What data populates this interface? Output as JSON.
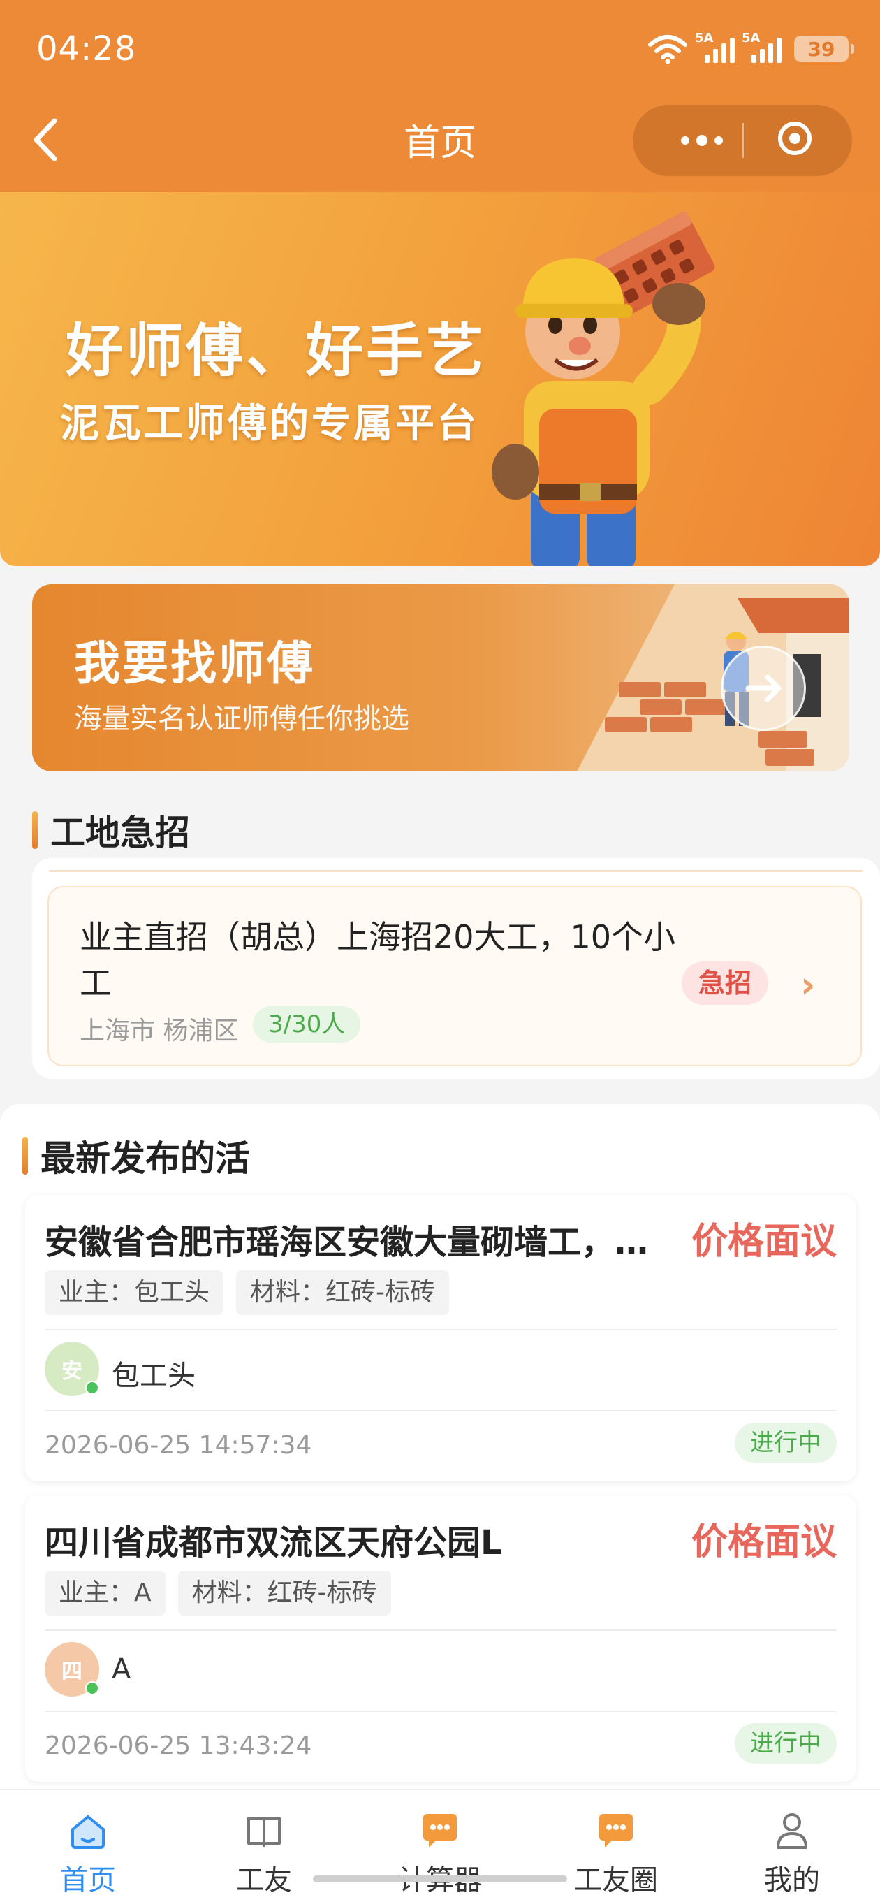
{
  "status_bar": {
    "time": "04:28",
    "net1": "5A",
    "net2": "5A",
    "battery": "39"
  },
  "nav": {
    "title": "首页"
  },
  "hero": {
    "title": "好师傅、好手艺",
    "subtitle": "泥瓦工师傅的专属平台"
  },
  "find_master": {
    "title": "我要找师傅",
    "subtitle": "海量实名认证师傅任你挑选"
  },
  "urgent": {
    "heading": "工地急招",
    "item": {
      "title": "业主直招（胡总）上海招20大工，10个小工",
      "location": "上海市 杨浦区",
      "count": "3/30人",
      "badge": "急招"
    }
  },
  "latest": {
    "heading": "最新发布的活",
    "jobs": [
      {
        "title": "安徽省合肥市瑶海区安徽大量砌墙工，…",
        "price": "价格面议",
        "owner_tag": "业主：包工头",
        "material_tag": "材料：红砖-标砖",
        "avatar_char": "安",
        "poster": "包工头",
        "time": "2026-06-25 14:57:34",
        "status": "进行中"
      },
      {
        "title": "四川省成都市双流区天府公园L",
        "price": "价格面议",
        "owner_tag": "业主：A",
        "material_tag": "材料：红砖-标砖",
        "avatar_char": "四",
        "poster": "A",
        "time": "2026-06-25 13:43:24",
        "status": "进行中"
      }
    ]
  },
  "tabbar": {
    "items": [
      {
        "label": "首页",
        "icon": "home-icon"
      },
      {
        "label": "工友",
        "icon": "book-icon"
      },
      {
        "label": "计算器",
        "icon": "chat-bubble-icon"
      },
      {
        "label": "工友圈",
        "icon": "chat-bubble-icon"
      },
      {
        "label": "我的",
        "icon": "user-icon"
      }
    ]
  },
  "colors": {
    "header": "#ec8a38",
    "accent_blue": "#2f8ef0",
    "price_red": "#e8675d",
    "status_green": "#4caa4c"
  }
}
